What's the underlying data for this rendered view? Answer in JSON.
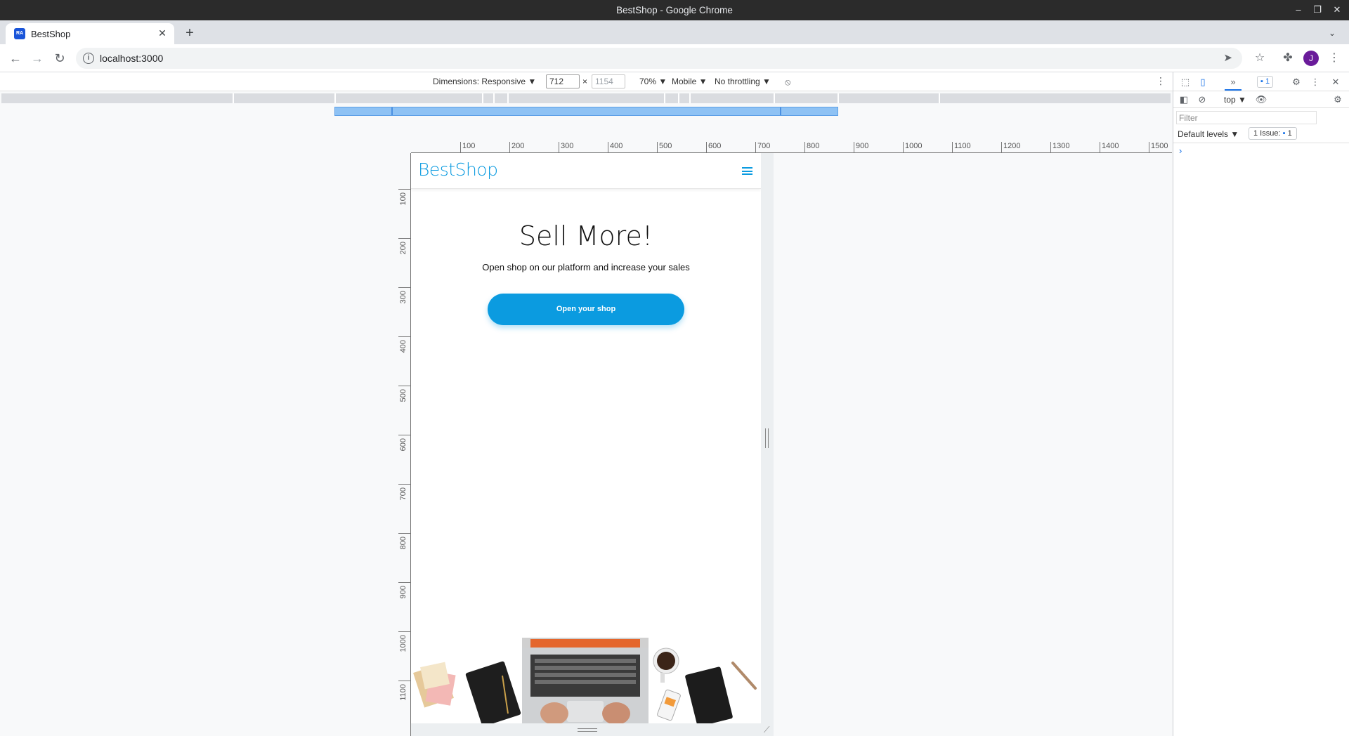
{
  "window": {
    "title": "BestShop - Google Chrome"
  },
  "tab": {
    "favicon_text": "RA",
    "title": "BestShop"
  },
  "address_bar": {
    "url": "localhost:3000"
  },
  "device_toolbar": {
    "dimensions_label": "Dimensions: Responsive ▼",
    "width_value": "712",
    "times": "×",
    "height_placeholder": "1154",
    "zoom": "70% ▼",
    "device_type": "Mobile ▼",
    "throttling": "No throttling ▼"
  },
  "ruler": {
    "horizontal": [
      "100",
      "200",
      "300",
      "400",
      "500",
      "600",
      "700",
      "800",
      "900",
      "1000",
      "1100",
      "1200",
      "1300",
      "1400",
      "1500"
    ],
    "vertical": [
      "100",
      "200",
      "300",
      "400",
      "500",
      "600",
      "700",
      "800",
      "900",
      "1000",
      "1100"
    ]
  },
  "site": {
    "logo": "BestShop",
    "hero_title": "Sell More!",
    "hero_subtitle": "Open shop on our platform and increase your sales",
    "cta_label": "Open your shop"
  },
  "devtools": {
    "messages_badge": "1",
    "context": "top ▼",
    "filter_placeholder": "Filter",
    "levels": "Default levels ▼",
    "issues_label": "1 Issue:",
    "issues_count": "1",
    "prompt": "›"
  },
  "profile": {
    "initial": "J"
  },
  "colors": {
    "brand": "#0b9be0",
    "avatar": "#6a1b9a",
    "devtools_accent": "#1a73e8"
  }
}
